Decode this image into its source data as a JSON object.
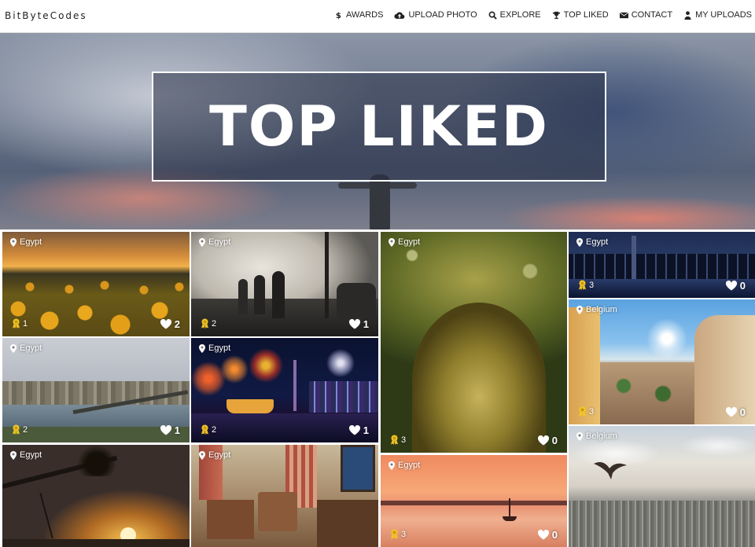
{
  "brand": "BitByteCodes",
  "nav": [
    {
      "label": "AWARDS",
      "icon": "dollar-icon"
    },
    {
      "label": "UPLOAD PHOTO",
      "icon": "cloud-upload-icon"
    },
    {
      "label": "EXPLORE",
      "icon": "search-icon"
    },
    {
      "label": "TOP LIKED",
      "icon": "trophy-icon"
    },
    {
      "label": "CONTACT",
      "icon": "envelope-icon"
    },
    {
      "label": "MY UPLOADS",
      "icon": "user-icon"
    }
  ],
  "hero": {
    "title": "TOP LIKED"
  },
  "photos": [
    {
      "location": "Egypt",
      "awards": "1",
      "likes": "2",
      "scene": "sunflowers"
    },
    {
      "location": "Egypt",
      "awards": "2",
      "likes": "1",
      "scene": "foggy-crowd"
    },
    {
      "location": "Egypt",
      "awards": "3",
      "likes": "0",
      "scene": "mossy-tree"
    },
    {
      "location": "Egypt",
      "awards": "3",
      "likes": "0",
      "scene": "city-night-skyline"
    },
    {
      "location": "Egypt",
      "awards": "2",
      "likes": "1",
      "scene": "cairo-river"
    },
    {
      "location": "Egypt",
      "awards": "2",
      "likes": "1",
      "scene": "fireworks-harbor"
    },
    {
      "location": "Belgium",
      "awards": "3",
      "likes": "0",
      "scene": "resort-panorama"
    },
    {
      "location": "Egypt",
      "awards": "",
      "likes": "",
      "scene": "palm-sunset"
    },
    {
      "location": "Egypt",
      "awards": "",
      "likes": "",
      "scene": "hotel-room"
    },
    {
      "location": "Egypt",
      "awards": "3",
      "likes": "0",
      "scene": "lake-sunset"
    },
    {
      "location": "Belgium",
      "awards": "",
      "likes": "",
      "scene": "bird-over-city"
    }
  ],
  "colors": {
    "award": "#f3c623",
    "brand_text": "#222222"
  }
}
